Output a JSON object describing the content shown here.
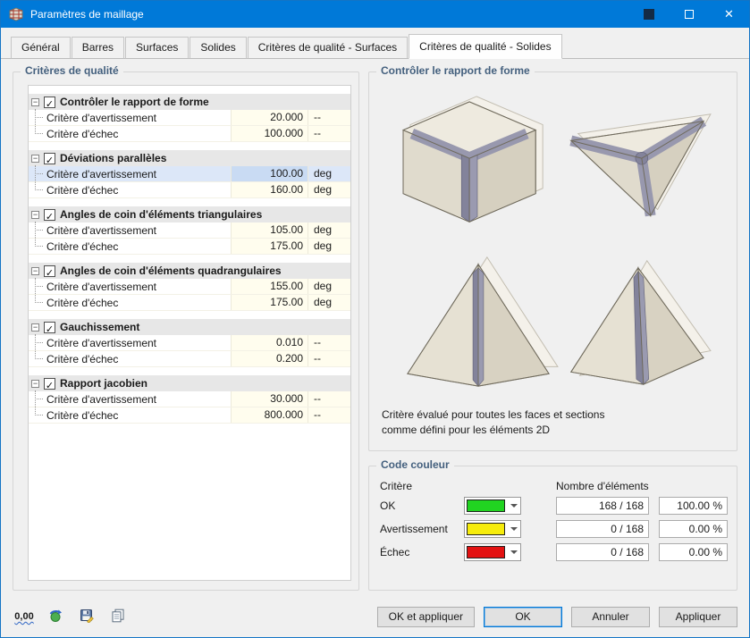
{
  "window": {
    "title": "Paramètres de maillage"
  },
  "tabs": [
    "Général",
    "Barres",
    "Surfaces",
    "Solides",
    "Critères de qualité - Surfaces",
    "Critères de qualité - Solides"
  ],
  "active_tab": "Critères de qualité - Solides",
  "quality": {
    "group_title": "Critères de qualité",
    "groups": [
      {
        "label": "Contrôler le rapport de forme",
        "checked": true,
        "children": [
          {
            "label": "Critère d'avertissement",
            "value": "20.000",
            "unit": "--"
          },
          {
            "label": "Critère d'échec",
            "value": "100.000",
            "unit": "--"
          }
        ]
      },
      {
        "label": "Déviations parallèles",
        "checked": true,
        "children": [
          {
            "label": "Critère d'avertissement",
            "value": "100.00",
            "unit": "deg"
          },
          {
            "label": "Critère d'échec",
            "value": "160.00",
            "unit": "deg"
          }
        ]
      },
      {
        "label": "Angles de coin d'éléments triangulaires",
        "checked": true,
        "children": [
          {
            "label": "Critère d'avertissement",
            "value": "105.00",
            "unit": "deg"
          },
          {
            "label": "Critère d'échec",
            "value": "175.00",
            "unit": "deg"
          }
        ]
      },
      {
        "label": "Angles de coin d'éléments quadrangulaires",
        "checked": true,
        "children": [
          {
            "label": "Critère d'avertissement",
            "value": "155.00",
            "unit": "deg"
          },
          {
            "label": "Critère d'échec",
            "value": "175.00",
            "unit": "deg"
          }
        ]
      },
      {
        "label": "Gauchissement",
        "checked": true,
        "children": [
          {
            "label": "Critère d'avertissement",
            "value": "0.010",
            "unit": "--"
          },
          {
            "label": "Critère d'échec",
            "value": "0.200",
            "unit": "--"
          }
        ]
      },
      {
        "label": "Rapport jacobien",
        "checked": true,
        "children": [
          {
            "label": "Critère d'avertissement",
            "value": "30.000",
            "unit": "--"
          },
          {
            "label": "Critère d'échec",
            "value": "800.000",
            "unit": "--"
          }
        ]
      }
    ]
  },
  "preview": {
    "group_title": "Contrôler le rapport de forme",
    "caption_line1": "Critère évalué pour toutes les faces et sections",
    "caption_line2": "comme défini pour les éléments 2D"
  },
  "color_code": {
    "group_title": "Code couleur",
    "col_criterion": "Critère",
    "col_elements": "Nombre d'éléments",
    "rows": [
      {
        "label": "OK",
        "color": "#21d421",
        "count": "168 / 168",
        "percent": "100.00 %"
      },
      {
        "label": "Avertissement",
        "color": "#f6ec0c",
        "count": "0 / 168",
        "percent": "0.00 %"
      },
      {
        "label": "Échec",
        "color": "#e31212",
        "count": "0 / 168",
        "percent": "0.00 %"
      }
    ]
  },
  "footer": {
    "units_label": "0,00",
    "buttons": [
      "OK et appliquer",
      "OK",
      "Annuler",
      "Appliquer"
    ]
  }
}
